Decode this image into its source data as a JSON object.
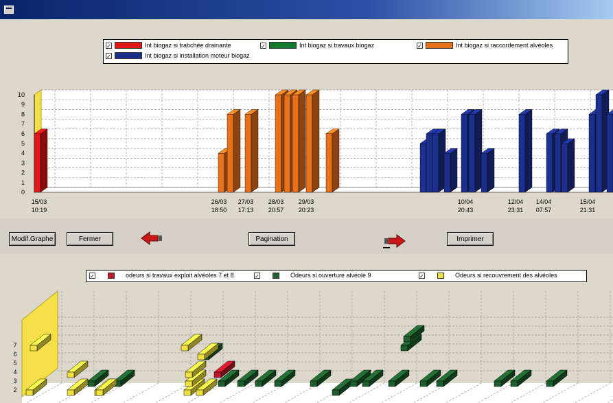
{
  "top_chart": {
    "legend": [
      {
        "label": "Int biogaz si trabchée drainante",
        "color": "#e01818",
        "checked": "✓"
      },
      {
        "label": "Int biogaz si travaux biogaz",
        "color": "#137a2e",
        "checked": "✓"
      },
      {
        "label": "Int biogaz si raccordement alvéoles",
        "color": "#e8721c",
        "checked": "✓"
      },
      {
        "label": "Int biogaz si installation moteur biogaz",
        "color": "#1c2f8c",
        "checked": "✓"
      }
    ],
    "y_ticks": [
      "0",
      "1",
      "2",
      "3",
      "4",
      "5",
      "6",
      "7",
      "8",
      "9",
      "10"
    ],
    "x_labels": [
      {
        "date": "15/03",
        "time": "10:19"
      },
      {
        "date": "26/03",
        "time": "18:50"
      },
      {
        "date": "27/03",
        "time": "17:13"
      },
      {
        "date": "28/03",
        "time": "20:57"
      },
      {
        "date": "29/03",
        "time": "20:23"
      },
      {
        "date": "10/04",
        "time": "20:43"
      },
      {
        "date": "12/04",
        "time": "23:31"
      },
      {
        "date": "14/04",
        "time": "07:57"
      },
      {
        "date": "15/04",
        "time": "21:31"
      }
    ]
  },
  "chart_data": [
    {
      "type": "bar",
      "ylim": [
        0,
        10
      ],
      "series": [
        {
          "name": "Int biogaz si trabchée drainante",
          "values": [
            6
          ]
        },
        {
          "name": "Int biogaz si raccordement alvéoles",
          "values": [
            4,
            8,
            8,
            10,
            10,
            10,
            10,
            6
          ]
        },
        {
          "name": "Int biogaz si installation moteur biogaz",
          "values": [
            5,
            6,
            6,
            4,
            8,
            8,
            4,
            8,
            6,
            6,
            5,
            8,
            10,
            8
          ]
        }
      ]
    },
    {
      "type": "scatter",
      "series": [
        {
          "name": "odeurs si travaux exploit alvéoles 7 et 8",
          "values": [
            4
          ]
        },
        {
          "name": "Odeurs si ouverture alvéole 9",
          "values": [
            3,
            3,
            3,
            3,
            3,
            3,
            3,
            2,
            3,
            3,
            3,
            3,
            3,
            3,
            3,
            3,
            7,
            8,
            6
          ]
        },
        {
          "name": "Odeurs si recouvrement des alvéoles",
          "values": [
            2,
            4,
            7,
            2,
            2,
            2,
            3,
            7,
            6,
            4,
            2,
            2
          ]
        }
      ]
    }
  ],
  "buttons": {
    "modif": "Modif.Graphe",
    "fermer": "Fermer",
    "pagination": "Pagination",
    "imprimer": "Imprimer"
  },
  "bottom_chart": {
    "legend": [
      {
        "label": "odeurs si travaux exploit alvéoles 7 et 8",
        "color": "#c0182a",
        "checked": "✓"
      },
      {
        "label": "Odeurs si ouverture alvéole 9",
        "color": "#1e5e2c",
        "checked": "✓"
      },
      {
        "label": "Odeurs si recouvrement des alvéoles",
        "color": "#f0e040",
        "checked": "✓"
      }
    ],
    "y_ticks": [
      "2",
      "3",
      "4",
      "5",
      "6",
      "7"
    ]
  }
}
